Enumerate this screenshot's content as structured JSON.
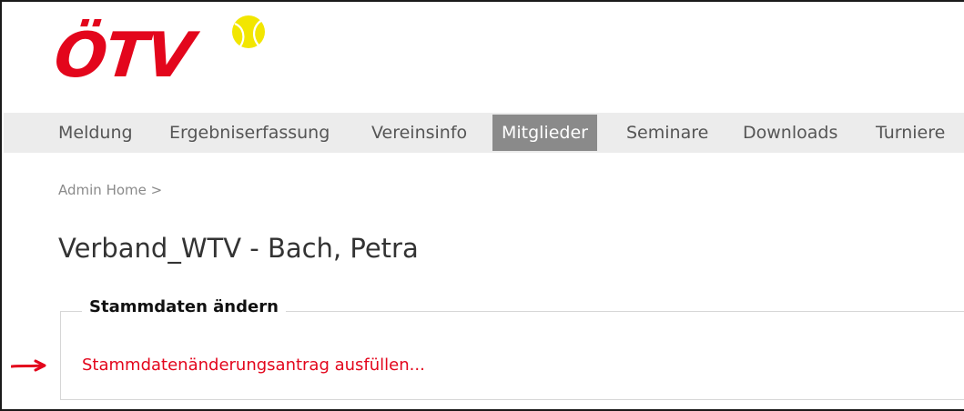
{
  "logo": {
    "text": "ÖTV",
    "brand_color": "#e3061c",
    "ball_color": "#f2e600",
    "icon": "tennis-ball-icon"
  },
  "nav": {
    "items": [
      {
        "label": "Meldung",
        "active": false
      },
      {
        "label": "Ergebniserfassung",
        "active": false
      },
      {
        "label": "Vereinsinfo",
        "active": false
      },
      {
        "label": "Mitglieder",
        "active": true
      },
      {
        "label": "Seminare",
        "active": false
      },
      {
        "label": "Downloads",
        "active": false
      },
      {
        "label": "Turniere",
        "active": false
      }
    ],
    "background": "#ececec",
    "active_background": "#8a8a8a"
  },
  "breadcrumb": {
    "home": "Admin Home",
    "separator": ">"
  },
  "page": {
    "title": "Verband_WTV - Bach, Petra"
  },
  "section": {
    "legend": "Stammdaten ändern",
    "link": "Stammdatenänderungsantrag ausfüllen...",
    "link_color": "#e3061c"
  },
  "annotation": {
    "icon": "arrow-right-icon",
    "color": "#e3061c"
  }
}
